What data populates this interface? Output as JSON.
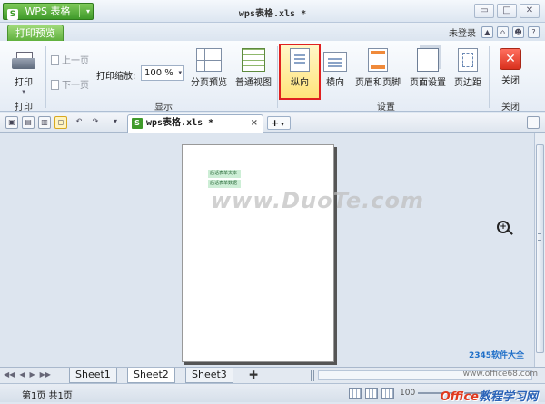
{
  "app": {
    "logo_glyph": "S",
    "name": "WPS 表格",
    "menu_arrow": "▾",
    "window_title": "wps表格.xls *",
    "window_buttons": [
      "▭",
      "□",
      "✕"
    ]
  },
  "tabs": {
    "active": "打印预览",
    "login": "未登录",
    "right_icons": [
      "▲",
      "⌂",
      "☻",
      "?"
    ]
  },
  "ribbon": {
    "print": {
      "label": "打印",
      "arrow": "▾"
    },
    "prev_page": "上一页",
    "next_page": "下一页",
    "zoom_label": "打印缩放:",
    "zoom_value": "100 %",
    "zoom_arrow": "▾",
    "page_break_preview": "分页预览",
    "normal_view": "普通视图",
    "portrait": "纵向",
    "landscape": "横向",
    "header_footer": "页眉和页脚",
    "page_setup": "页面设置",
    "margins": "页边距",
    "close": "关闭",
    "close_glyph": "✕",
    "group_print": "打印",
    "group_display": "显示",
    "group_settings": "设置",
    "group_close": "关闭"
  },
  "toolbar": {
    "doc_tab": "wps表格.xls *",
    "doc_tab_icon": "S",
    "doc_tab_close": "×",
    "new_tab": "+",
    "new_tab_arrow": "▾",
    "quick_icons": [
      "▣",
      "▤",
      "▥",
      "◻",
      "↶",
      "↷",
      "▾"
    ]
  },
  "preview": {
    "cells": [
      "后话表单文本",
      "后话表单数据"
    ],
    "watermark": "www.DuoTe.com"
  },
  "sheets": {
    "nav": [
      "◀◀",
      "◀",
      "▶",
      "▶▶"
    ],
    "tabs": [
      "Sheet1",
      "Sheet2",
      "Sheet3"
    ],
    "active_index": 1,
    "add": "✚"
  },
  "status": {
    "page_info": "第1页 共1页",
    "zoom_pct": "100",
    "brand_part1": "Office",
    "brand_part2": "教程学习网",
    "brand_url": "www.office68.com",
    "badge": "2345软件大全"
  }
}
